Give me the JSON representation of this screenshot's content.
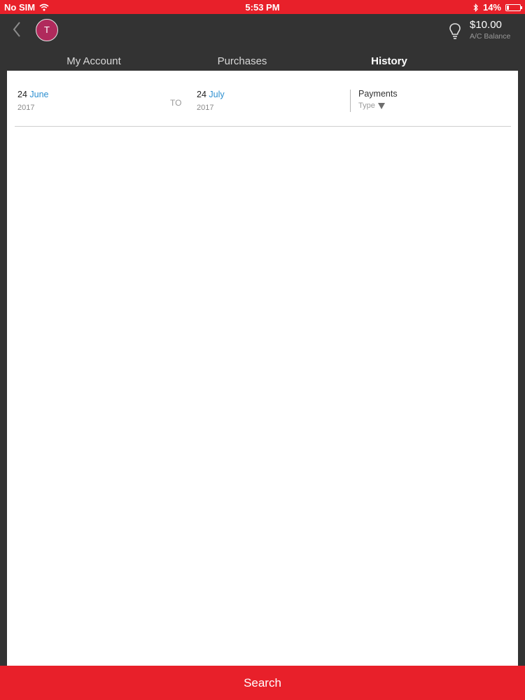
{
  "status_bar": {
    "carrier": "No SIM",
    "time": "5:53 PM",
    "battery_percent": "14%",
    "battery_level": 0.14,
    "icons": [
      "wifi-icon",
      "bluetooth-icon",
      "battery-icon"
    ]
  },
  "header": {
    "avatar_initial": "T",
    "balance_amount": "$10.00",
    "balance_label": "A/C Balance",
    "icons": [
      "back-chevron-icon",
      "lightbulb-icon"
    ]
  },
  "tabs": [
    {
      "label": "My Account",
      "active": false
    },
    {
      "label": "Purchases",
      "active": false
    },
    {
      "label": "History",
      "active": true
    }
  ],
  "filter": {
    "from": {
      "day": "24",
      "month": "June",
      "year": "2017"
    },
    "to_label": "TO",
    "to": {
      "day": "24",
      "month": "July",
      "year": "2017"
    },
    "payments_title": "Payments",
    "type_placeholder": "Type"
  },
  "search_button_label": "Search",
  "colors": {
    "accent": "#e8202a",
    "header_bg": "#333333",
    "link_blue": "#2c8fd0",
    "avatar_bg": "#b02a5c"
  }
}
